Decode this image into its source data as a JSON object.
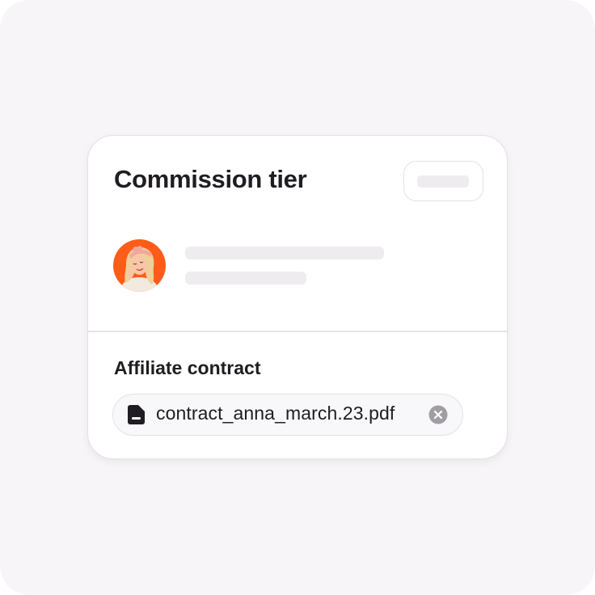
{
  "card": {
    "title": "Commission tier",
    "icons": {
      "avatar": "user-avatar-photo"
    }
  },
  "contract": {
    "section_label": "Affiliate contract",
    "file_name": "contract_anna_march.23.pdf",
    "icons": {
      "file": "document-icon",
      "remove": "close-circle-icon"
    }
  },
  "colors": {
    "avatar_background": "#ff5c1a",
    "skeleton": "#eeecef",
    "text": "#1f1d22"
  }
}
